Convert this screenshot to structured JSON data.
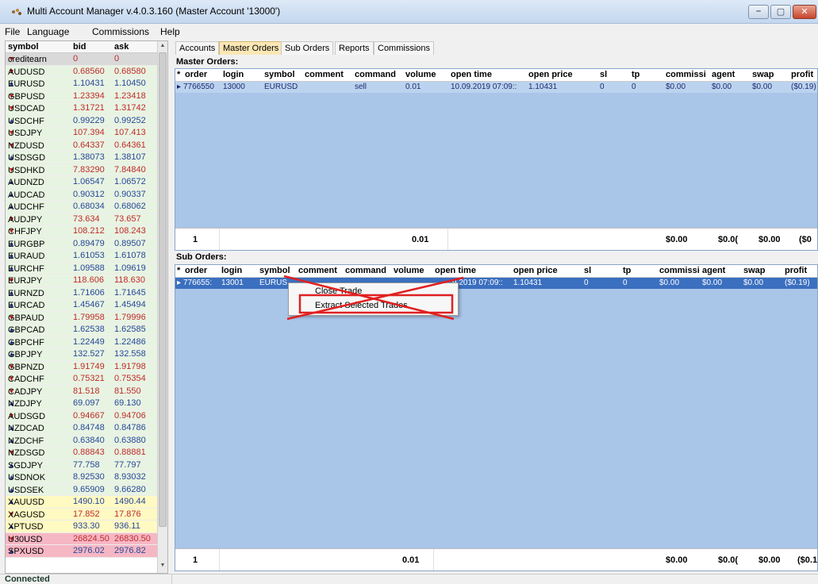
{
  "window": {
    "title": "Multi Account Manager v.4.0.3.160 (Master Account '13000')"
  },
  "menu": [
    "File",
    "Language",
    "Commissions",
    "Help"
  ],
  "quotes": {
    "headers": {
      "symbol": "symbol",
      "bid": "bid",
      "ask": "ask"
    },
    "rows": [
      {
        "symbol": "creditearn",
        "bid": "0",
        "ask": "0",
        "dir": "down",
        "style": "sel"
      },
      {
        "symbol": "AUDUSD",
        "bid": "0.68560",
        "ask": "0.68580",
        "dir": "down",
        "style": ""
      },
      {
        "symbol": "EURUSD",
        "bid": "1.10431",
        "ask": "1.10450",
        "dir": "up",
        "style": ""
      },
      {
        "symbol": "GBPUSD",
        "bid": "1.23394",
        "ask": "1.23418",
        "dir": "down",
        "style": ""
      },
      {
        "symbol": "USDCAD",
        "bid": "1.31721",
        "ask": "1.31742",
        "dir": "down",
        "style": ""
      },
      {
        "symbol": "USDCHF",
        "bid": "0.99229",
        "ask": "0.99252",
        "dir": "up",
        "style": ""
      },
      {
        "symbol": "USDJPY",
        "bid": "107.394",
        "ask": "107.413",
        "dir": "down",
        "style": ""
      },
      {
        "symbol": "NZDUSD",
        "bid": "0.64337",
        "ask": "0.64361",
        "dir": "down",
        "style": ""
      },
      {
        "symbol": "USDSGD",
        "bid": "1.38073",
        "ask": "1.38107",
        "dir": "up",
        "style": ""
      },
      {
        "symbol": "USDHKD",
        "bid": "7.83290",
        "ask": "7.84840",
        "dir": "down",
        "style": ""
      },
      {
        "symbol": "AUDNZD",
        "bid": "1.06547",
        "ask": "1.06572",
        "dir": "up",
        "style": ""
      },
      {
        "symbol": "AUDCAD",
        "bid": "0.90312",
        "ask": "0.90337",
        "dir": "up",
        "style": ""
      },
      {
        "symbol": "AUDCHF",
        "bid": "0.68034",
        "ask": "0.68062",
        "dir": "up",
        "style": ""
      },
      {
        "symbol": "AUDJPY",
        "bid": "73.634",
        "ask": "73.657",
        "dir": "down",
        "style": ""
      },
      {
        "symbol": "CHFJPY",
        "bid": "108.212",
        "ask": "108.243",
        "dir": "down",
        "style": ""
      },
      {
        "symbol": "EURGBP",
        "bid": "0.89479",
        "ask": "0.89507",
        "dir": "up",
        "style": ""
      },
      {
        "symbol": "EURAUD",
        "bid": "1.61053",
        "ask": "1.61078",
        "dir": "up",
        "style": ""
      },
      {
        "symbol": "EURCHF",
        "bid": "1.09588",
        "ask": "1.09619",
        "dir": "up",
        "style": ""
      },
      {
        "symbol": "EURJPY",
        "bid": "118.606",
        "ask": "118.630",
        "dir": "down",
        "style": ""
      },
      {
        "symbol": "EURNZD",
        "bid": "1.71606",
        "ask": "1.71645",
        "dir": "up",
        "style": ""
      },
      {
        "symbol": "EURCAD",
        "bid": "1.45467",
        "ask": "1.45494",
        "dir": "up",
        "style": ""
      },
      {
        "symbol": "GBPAUD",
        "bid": "1.79958",
        "ask": "1.79996",
        "dir": "down",
        "style": ""
      },
      {
        "symbol": "GBPCAD",
        "bid": "1.62538",
        "ask": "1.62585",
        "dir": "up",
        "style": ""
      },
      {
        "symbol": "GBPCHF",
        "bid": "1.22449",
        "ask": "1.22486",
        "dir": "up",
        "style": ""
      },
      {
        "symbol": "GBPJPY",
        "bid": "132.527",
        "ask": "132.558",
        "dir": "up",
        "style": ""
      },
      {
        "symbol": "GBPNZD",
        "bid": "1.91749",
        "ask": "1.91798",
        "dir": "down",
        "style": ""
      },
      {
        "symbol": "CADCHF",
        "bid": "0.75321",
        "ask": "0.75354",
        "dir": "down",
        "style": ""
      },
      {
        "symbol": "CADJPY",
        "bid": "81.518",
        "ask": "81.550",
        "dir": "down",
        "style": ""
      },
      {
        "symbol": "NZDJPY",
        "bid": "69.097",
        "ask": "69.130",
        "dir": "up",
        "style": ""
      },
      {
        "symbol": "AUDSGD",
        "bid": "0.94667",
        "ask": "0.94706",
        "dir": "down",
        "style": ""
      },
      {
        "symbol": "NZDCAD",
        "bid": "0.84748",
        "ask": "0.84786",
        "dir": "up",
        "style": ""
      },
      {
        "symbol": "NZDCHF",
        "bid": "0.63840",
        "ask": "0.63880",
        "dir": "up",
        "style": ""
      },
      {
        "symbol": "NZDSGD",
        "bid": "0.88843",
        "ask": "0.88881",
        "dir": "down",
        "style": ""
      },
      {
        "symbol": "SGDJPY",
        "bid": "77.758",
        "ask": "77.797",
        "dir": "up",
        "style": ""
      },
      {
        "symbol": "USDNOK",
        "bid": "8.92530",
        "ask": "8.93032",
        "dir": "up",
        "style": ""
      },
      {
        "symbol": "USDSEK",
        "bid": "9.65909",
        "ask": "9.66280",
        "dir": "up",
        "style": ""
      },
      {
        "symbol": "XAUUSD",
        "bid": "1490.10",
        "ask": "1490.44",
        "dir": "up",
        "style": "yellow"
      },
      {
        "symbol": "XAGUSD",
        "bid": "17.852",
        "ask": "17.876",
        "dir": "down",
        "style": "yellow"
      },
      {
        "symbol": "XPTUSD",
        "bid": "933.30",
        "ask": "936.11",
        "dir": "up",
        "style": "yellow"
      },
      {
        "symbol": "U30USD",
        "bid": "26824.50",
        "ask": "26830.50",
        "dir": "down",
        "style": "pink"
      },
      {
        "symbol": "SPXUSD",
        "bid": "2976.02",
        "ask": "2976.82",
        "dir": "up",
        "style": "pink"
      }
    ]
  },
  "status": {
    "text": "Connected"
  },
  "tabs": [
    "Accounts",
    "Master Orders",
    "Sub Orders",
    "Reports",
    "Commissions"
  ],
  "master": {
    "label": "Master Orders:",
    "headers": [
      "order",
      "login",
      "symbol",
      "comment",
      "command",
      "volume",
      "open time",
      "open price",
      "sl",
      "tp",
      "commissi",
      "agent",
      "swap",
      "profit"
    ],
    "row": {
      "order": "7766550",
      "login": "13000",
      "symbol": "EURUSD",
      "comment": "",
      "command": "sell",
      "volume": "0.01",
      "open_time": "10.09.2019 07:09::",
      "open_price": "1.10431",
      "sl": "0",
      "tp": "0",
      "commission": "$0.00",
      "agent": "$0.00",
      "swap": "$0.00",
      "profit": "($0.19)"
    },
    "footer": {
      "count": "1",
      "volume": "0.01",
      "commission": "$0.00",
      "agent": "$0.0(",
      "swap": "$0.00",
      "profit": "($0"
    }
  },
  "sub": {
    "label": "Sub Orders:",
    "headers": [
      "order",
      "login",
      "symbol",
      "comment",
      "command",
      "volume",
      "open time",
      "open price",
      "sl",
      "tp",
      "commissi",
      "agent",
      "swap",
      "profit"
    ],
    "row": {
      "order": "776655:",
      "login": "13001",
      "symbol": "EURUS",
      "open_time": "9.2019 07:09::",
      "open_price": "1.10431",
      "sl": "0",
      "tp": "0",
      "commission": "$0.00",
      "agent": "$0.00",
      "swap": "$0.00",
      "profit": "($0.19)"
    },
    "footer": {
      "count": "1",
      "volume": "0.01",
      "commission": "$0.00",
      "agent": "$0.0(",
      "swap": "$0.00",
      "profit": "($0.1"
    }
  },
  "context_menu": {
    "items": [
      "Close Trade",
      "Extract Selected Trades"
    ]
  },
  "colors": {
    "grid_bg": "#a9c5e8",
    "selected_row": "#3b6fbf",
    "annotation_red": "#e02020",
    "active_tab": "#fbe7b5"
  }
}
